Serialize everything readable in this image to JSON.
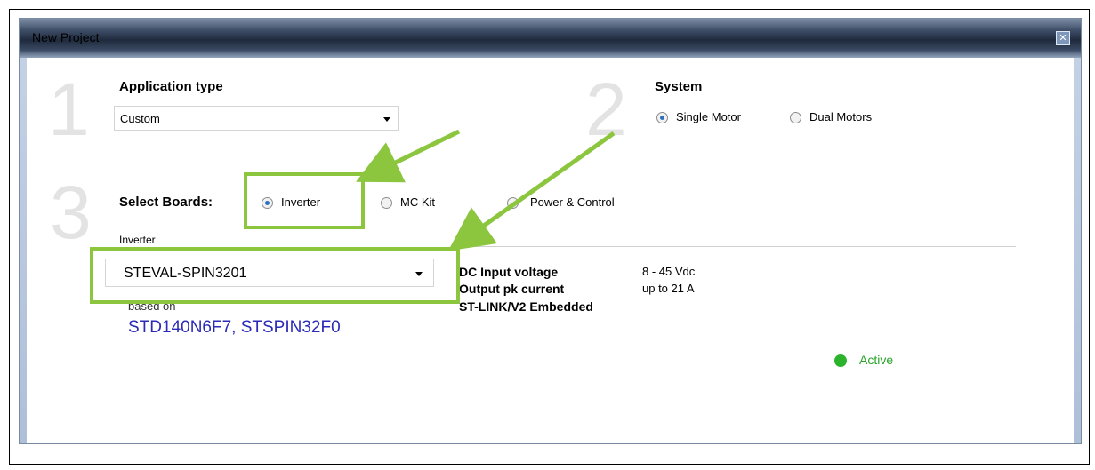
{
  "window": {
    "title": "New Project",
    "close_icon": "close-icon"
  },
  "steps": {
    "one": "1",
    "two": "2",
    "three": "3"
  },
  "application": {
    "label": "Application type",
    "value": "Custom"
  },
  "system": {
    "label": "System",
    "options": [
      "Single Motor",
      "Dual Motors"
    ],
    "selected": "Single Motor"
  },
  "boards": {
    "label": "Select Boards:",
    "options": [
      "Inverter",
      "MC Kit",
      "Power & Control"
    ],
    "selected": "Inverter"
  },
  "inverter": {
    "section_label": "Inverter",
    "value": "STEVAL-SPIN3201",
    "based_on_label": "based on",
    "based_on": "STD140N6F7, STSPIN32F0"
  },
  "specs": [
    {
      "label": "DC Input voltage",
      "value": "8 - 45 Vdc"
    },
    {
      "label": "Output pk current",
      "value": "up to 21 A"
    },
    {
      "label": "ST-LINK/V2 Embedded",
      "value": ""
    }
  ],
  "status": {
    "text": "Active",
    "color": "#2bb32b"
  },
  "annotation": {
    "color": "#8cc63f"
  }
}
